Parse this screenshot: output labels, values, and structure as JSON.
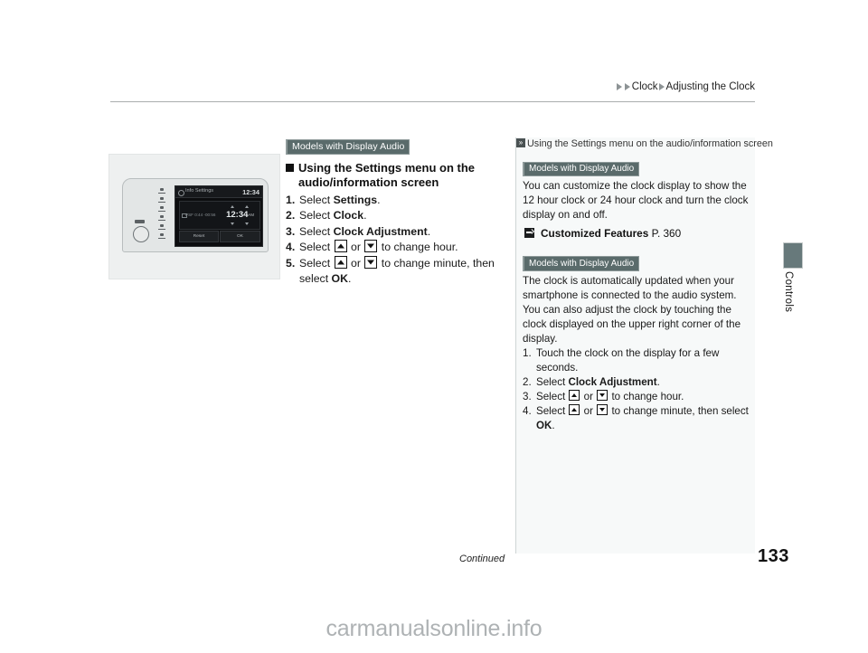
{
  "header": {
    "breadcrumb": [
      "Clock",
      "Adjusting the Clock"
    ]
  },
  "footer": {
    "continued": "Continued",
    "page_number": "133",
    "watermark": "carmanualsonline.info"
  },
  "side_tab": {
    "label": "Controls",
    "color": "#67797b"
  },
  "illustration": {
    "name": "audio-head-unit",
    "screen_title": "Info Settings",
    "screen_clock": "12:34",
    "psf_label": "PSF  0:44  -00:56",
    "time_hour": "12",
    "time_sep": ":",
    "time_minute": "34",
    "time_ampm": "AM",
    "button_reset": "Reset",
    "button_ok": "OK"
  },
  "left_column": {
    "badge": "Models with Display Audio",
    "section_heading": "Using the Settings menu on the audio/information screen",
    "steps": [
      {
        "num": "1.",
        "pre": "Select ",
        "bold": "Settings",
        "post": "."
      },
      {
        "num": "2.",
        "pre": "Select ",
        "bold": "Clock",
        "post": "."
      },
      {
        "num": "3.",
        "pre": "Select ",
        "bold": "Clock Adjustment",
        "post": "."
      },
      {
        "num": "4.",
        "pre": "Select ",
        "mid": " or ",
        "post": " to change hour."
      },
      {
        "num": "5.",
        "pre": "Select ",
        "mid": " or ",
        "post": " to change minute, then select ",
        "bold2": "OK",
        "tail": "."
      }
    ]
  },
  "right_column": {
    "note_title": "Using the Settings menu on the audio/information screen",
    "block1": {
      "badge": "Models with Display Audio",
      "body": "You can customize the clock display to show the 12 hour clock or 24 hour clock and turn the clock display on and off.",
      "xref_name": "Customized Features",
      "xref_page": "P. 360"
    },
    "block2": {
      "badge": "Models with Display Audio",
      "body": "The clock is automatically updated when your smartphone is connected to the audio system. You can also adjust the clock by touching the clock displayed on the upper right corner of the display.",
      "steps": [
        {
          "num": "1.",
          "pre": "Touch the clock on the display for a few seconds."
        },
        {
          "num": "2.",
          "pre": "Select ",
          "bold": "Clock Adjustment",
          "post": "."
        },
        {
          "num": "3.",
          "pre": "Select ",
          "mid": " or ",
          "post": " to change hour."
        },
        {
          "num": "4.",
          "pre": "Select ",
          "mid": " or ",
          "post": " to change minute, then select ",
          "bold2": "OK",
          "tail": "."
        }
      ]
    }
  }
}
